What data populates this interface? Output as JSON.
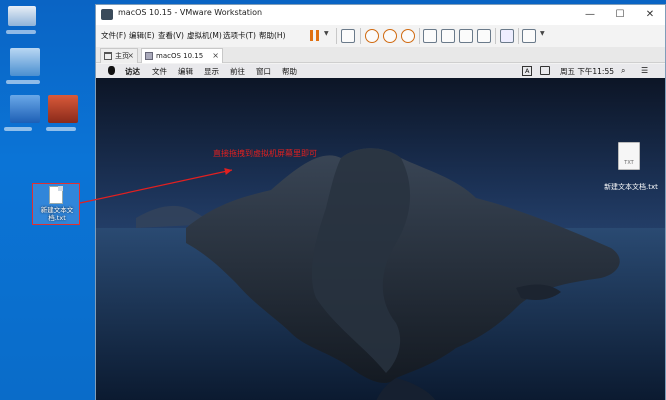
{
  "window": {
    "title": "macOS 10.15 - VMware Workstation",
    "controls": {
      "minimize": "—",
      "maximize": "☐",
      "close": "✕"
    }
  },
  "menu": [
    "文件(F)",
    "编辑(E)",
    "查看(V)",
    "虚拟机(M)",
    "选项卡(T)",
    "帮助(H)"
  ],
  "tabs": {
    "home": "主页",
    "vm": "macOS 10.15",
    "close": "×"
  },
  "guest": {
    "menu": [
      "访达",
      "文件",
      "编辑",
      "显示",
      "前往",
      "窗口",
      "帮助"
    ],
    "input_indicator": "A",
    "clock": "周五 下午11:55",
    "desktop_file": {
      "name": "新建文本文档.txt",
      "ext": "TXT"
    }
  },
  "host_desktop": {
    "file_label": "新建文本文档.txt"
  },
  "annotation": {
    "text": "直接拖拽到虚拟机屏幕里即可",
    "color": "#e12020"
  },
  "colors": {
    "desktop_bg": "#0a6cc8",
    "accent_pause": "#e07010"
  }
}
